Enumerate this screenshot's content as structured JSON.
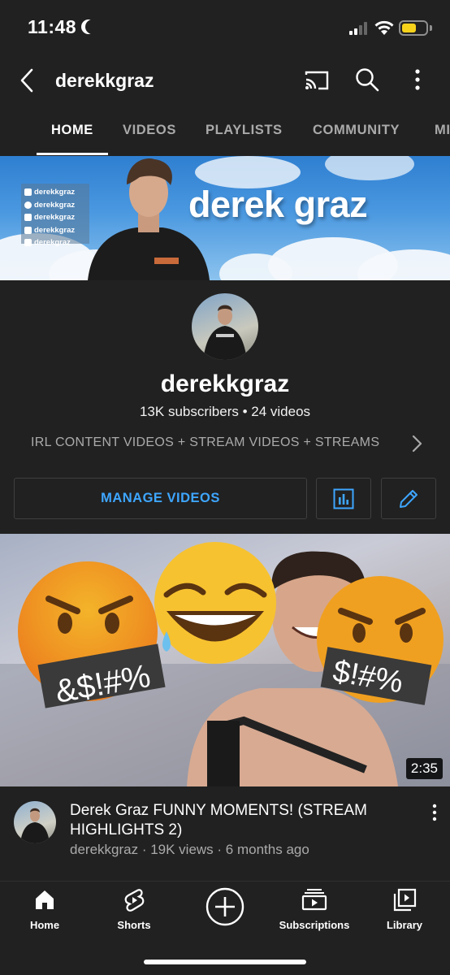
{
  "status_bar": {
    "time": "11:48",
    "battery_level": 0.6,
    "battery_color": "#f7d21b"
  },
  "header": {
    "title": "derekkgraz",
    "icons": [
      "back-icon",
      "cast-icon",
      "search-icon",
      "more-icon"
    ]
  },
  "tabs": [
    {
      "label": "HOME",
      "active": true
    },
    {
      "label": "VIDEOS",
      "active": false
    },
    {
      "label": "PLAYLISTS",
      "active": false
    },
    {
      "label": "COMMUNITY",
      "active": false
    },
    {
      "label": "MI",
      "active": false
    }
  ],
  "banner": {
    "name": "derek graz",
    "socials": [
      {
        "platform": "twitch",
        "handle": "derekkgraz"
      },
      {
        "platform": "instagram",
        "handle": "derekkgraz"
      },
      {
        "platform": "twitter",
        "handle": "derekkgraz"
      },
      {
        "platform": "tiktok",
        "handle": "derekkgraz"
      },
      {
        "platform": "youtube",
        "handle": "derekgraz"
      }
    ]
  },
  "channel": {
    "name": "derekkgraz",
    "stats": "13K subscribers • 24 videos",
    "description": "IRL CONTENT VIDEOS + STREAM VIDEOS + STREAMS"
  },
  "actions": {
    "manage_label": "MANAGE VIDEOS",
    "accent_color": "#3ea6ff"
  },
  "video": {
    "duration": "2:35",
    "title": "Derek Graz FUNNY MOMENTS! (STREAM HIGHLIGHTS 2)",
    "subtitle": "derekkgraz · 19K views · 6 months ago",
    "thumbnail_text_left": "&$!#%",
    "thumbnail_text_right": "$!#%"
  },
  "bottom_nav": [
    {
      "label": "Home",
      "icon": "home-icon"
    },
    {
      "label": "Shorts",
      "icon": "shorts-icon"
    },
    {
      "label": "",
      "icon": "create-icon"
    },
    {
      "label": "Subscriptions",
      "icon": "subscriptions-icon"
    },
    {
      "label": "Library",
      "icon": "library-icon"
    }
  ]
}
